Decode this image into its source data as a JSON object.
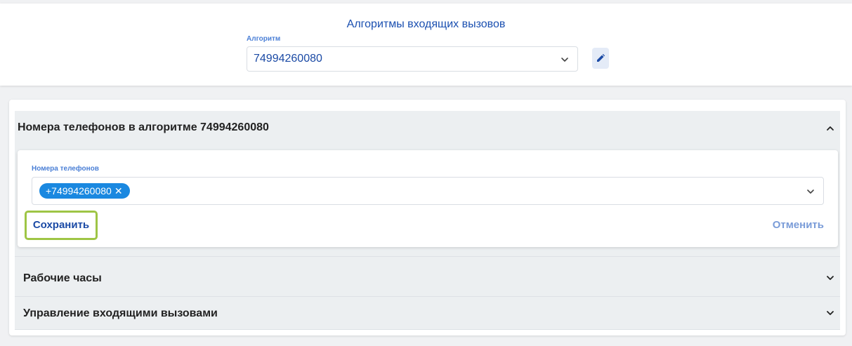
{
  "header": {
    "title": "Алгоритмы входящих вызовов",
    "algorithm_label": "Алгоритм",
    "algorithm_value": "74994260080",
    "edit_icon": "pencil-icon"
  },
  "sections": {
    "phones": {
      "title": "Номера телефонов в алгоритме 74994260080",
      "expanded": true,
      "field_label": "Номера телефонов",
      "chips": [
        "+74994260080"
      ],
      "chip_remove_symbol": "✕",
      "save_label": "Сохранить",
      "cancel_label": "Отменить"
    },
    "hours": {
      "title": "Рабочие часы",
      "expanded": false
    },
    "incoming": {
      "title": "Управление входящими вызовами",
      "expanded": false
    }
  },
  "colors": {
    "accent": "#1a4fb0",
    "chip": "#1a88e0",
    "highlight_border": "#9ec545",
    "panel_header_bg": "#eceff1"
  }
}
